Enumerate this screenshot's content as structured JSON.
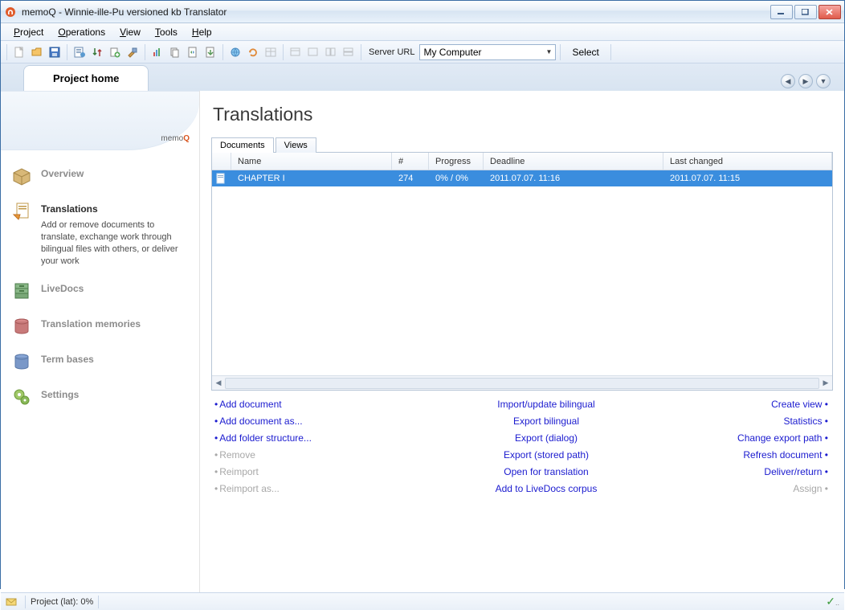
{
  "window": {
    "title": "memoQ - Winnie-ille-Pu versioned kb Translator"
  },
  "menu": {
    "project": "Project",
    "operations": "Operations",
    "view": "View",
    "tools": "Tools",
    "help": "Help"
  },
  "toolbar": {
    "server_url_label": "Server URL",
    "server_url_value": "My Computer",
    "select": "Select"
  },
  "tabs": {
    "project_home": "Project home"
  },
  "sidebar": {
    "logo": "memo",
    "overview": "Overview",
    "translations": "Translations",
    "translations_desc": "Add or remove documents to translate, exchange work through bilingual files with others, or deliver your work",
    "livedocs": "LiveDocs",
    "tm": "Translation memories",
    "tb": "Term bases",
    "settings": "Settings"
  },
  "page": {
    "title": "Translations"
  },
  "subtabs": {
    "documents": "Documents",
    "views": "Views"
  },
  "columns": {
    "name": "Name",
    "num": "#",
    "progress": "Progress",
    "deadline": "Deadline",
    "changed": "Last changed"
  },
  "rows": [
    {
      "name": "CHAPTER I",
      "num": "274",
      "progress": "0% / 0%",
      "deadline": "2011.07.07. 11:16",
      "changed": "2011.07.07. 11:15"
    }
  ],
  "actions": {
    "add_doc": "Add document",
    "add_doc_as": "Add document as...",
    "add_folder": "Add folder structure...",
    "remove": "Remove",
    "reimport": "Reimport",
    "reimport_as": "Reimport as...",
    "import_bilingual": "Import/update bilingual",
    "export_bilingual": "Export bilingual",
    "export_dialog": "Export (dialog)",
    "export_stored": "Export (stored path)",
    "open_trans": "Open for translation",
    "add_livedocs": "Add to LiveDocs corpus",
    "create_view": "Create view",
    "statistics": "Statistics",
    "change_export": "Change export path",
    "refresh_doc": "Refresh document",
    "deliver": "Deliver/return",
    "assign": "Assign"
  },
  "status": {
    "project": "Project (lat): 0%"
  }
}
